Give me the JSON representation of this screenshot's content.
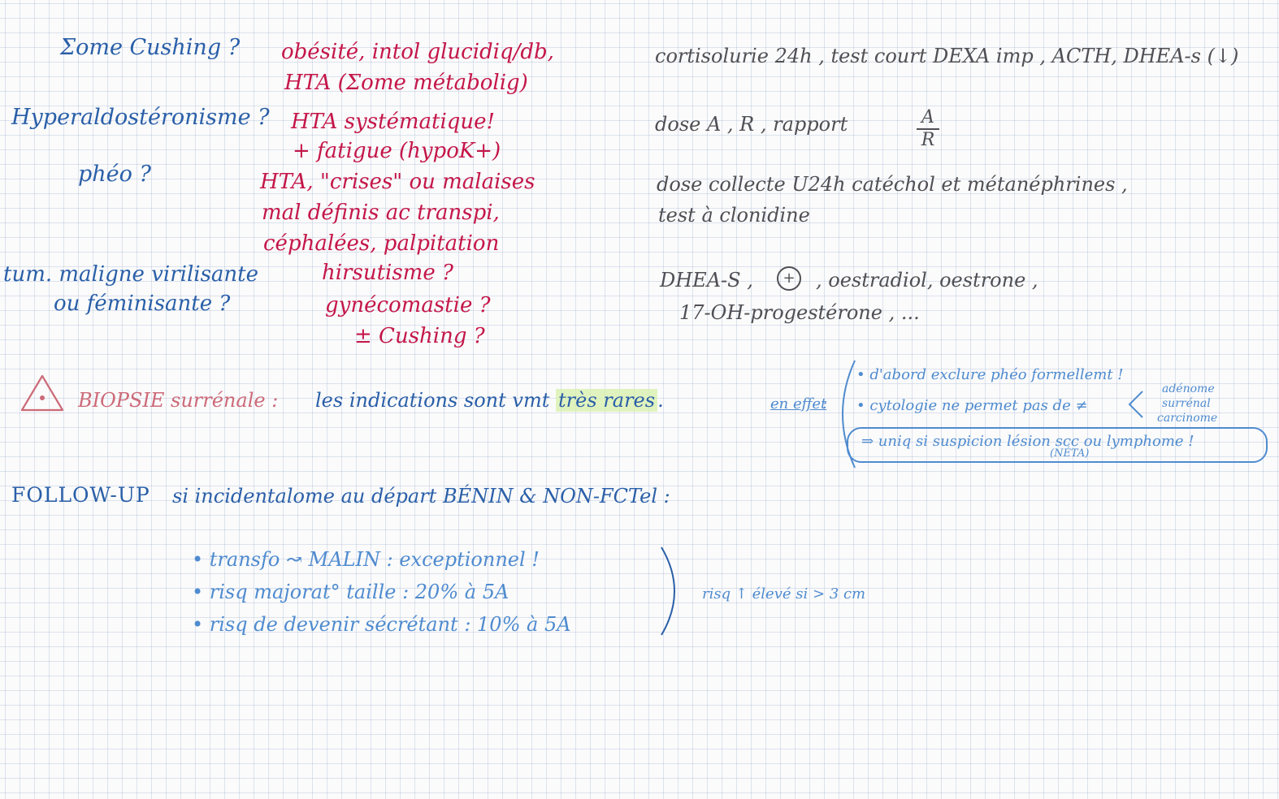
{
  "questions": {
    "cushing": "Σome Cushing ?",
    "hyperaldo": "Hyperaldostéronisme ?",
    "pheo": "phéo ?",
    "tumor_line1": "tum. maligne virilisante",
    "tumor_line2": "ou féminisante ?"
  },
  "signs": {
    "cushing_l1": "obésité, intol glucidiq/db,",
    "cushing_l2": "HTA (Σome métabolig)",
    "aldo_l1": "HTA systématique!",
    "aldo_l2": "+ fatigue (hypoK+)",
    "pheo_l1": "HTA, \"crises\" ou malaises",
    "pheo_l2": "mal définis ac transpi,",
    "pheo_l3": "céphalées, palpitation",
    "tumor_l1": "hirsutisme ?",
    "tumor_l2": "gynécomastie ?",
    "tumor_l3": "± Cushing ?"
  },
  "tests": {
    "cushing": "cortisolurie 24h , test court DEXA imp , ACTH, DHEA-s (↓)",
    "aldo_prefix": "dose A , R , rapport",
    "aldo_num": "A",
    "aldo_den": "R",
    "pheo_l1": "dose collecte U24h catéchol et métanéphrines ,",
    "pheo_l2": "test à clonidine",
    "tumor_l1_a": "DHEA-S ,",
    "tumor_l1_sign": "+",
    "tumor_l1_b": ", oestradiol, oestrone ,",
    "tumor_l2": "17-OH-progestérone , ..."
  },
  "biopsy": {
    "title": "BIOPSIE surrénale :",
    "text_a": "les indications sont vmt",
    "highlight": "très rares",
    "text_b": ".",
    "en_effet": "en effet",
    "colon": ":",
    "bullet1": "• d'abord exclure phéo formellemt !",
    "bullet2": "• cytologie ne permet pas de ≠",
    "adenome": "adénome",
    "surrenal": "surrénal",
    "carcinome": "carcinome",
    "circled": "⇒ uniq si suspicion lésion scc ou lymphome !",
    "neta": "(NÉTA)"
  },
  "followup": {
    "title": "FOLLOW-UP",
    "rest": "si incidentalome au départ BÉNIN & NON-FCTel :",
    "items": [
      "• transfo ↝ MALIN : exceptionnel !",
      "• risq majorat° taille : 20% à 5A",
      "• risq de devenir sécrétant : 10% à 5A"
    ],
    "side_note": "risq ↑ élevé si > 3 cm"
  },
  "colors": {
    "blue_ink": "#2a5fa8",
    "light_blue_ink": "#4f8bcf",
    "gray_ink": "#4f4f55",
    "red_ink": "#c4174a",
    "warning_pink": "#cc6a78",
    "highlighter_green": "#d7f0aa"
  },
  "icons": {
    "warning": "warning-triangle-icon",
    "circled_plus": "circled-plus-icon"
  }
}
